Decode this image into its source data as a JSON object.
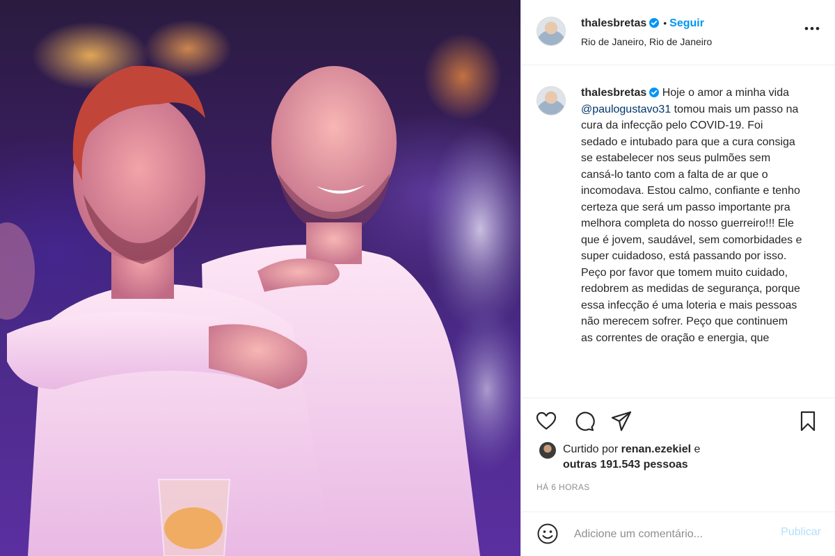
{
  "header": {
    "username": "thalesbretas",
    "separator": "•",
    "follow_label": "Seguir",
    "location": "Rio de Janeiro, Rio de Janeiro"
  },
  "caption": {
    "username": "thalesbretas",
    "text_before": "Hoje o amor a minha vida ",
    "mention": "@paulogustavo31",
    "text_after": " tomou mais um passo na cura da infecção pelo COVID-19. Foi sedado e intubado para que a cura consiga se estabelecer nos seus pulmões sem cansá-lo tanto com a falta de ar que o incomodava. Estou calmo, confiante e tenho certeza que será um passo importante pra melhora completa do nosso guerreiro!!! Ele que é jovem, saudável, sem comorbidades e super cuidadoso, está passando por isso. Peço por favor que tomem muito cuidado, redobrem as medidas de segurança, porque essa infecção é uma loteria e mais pessoas não merecem sofrer. Peço que continuem as correntes de oração e energia, que"
  },
  "likes": {
    "prefix": "Curtido por ",
    "user": "renan.ezekiel",
    "middle": " e",
    "others": "outras 191.543 pessoas"
  },
  "timestamp": "HÁ 6 HORAS",
  "comment": {
    "placeholder": "Adicione um comentário...",
    "publish_label": "Publicar"
  },
  "icons": {
    "verified": "verified-badge-icon",
    "more": "more-options-icon",
    "like": "heart-icon",
    "comment": "comment-icon",
    "share": "paper-plane-icon",
    "save": "bookmark-icon",
    "emoji": "smiley-icon"
  },
  "colors": {
    "accent": "#0095f6",
    "mention": "#00376b",
    "publish_disabled": "#b2dffc",
    "muted": "#8e8e8e"
  }
}
